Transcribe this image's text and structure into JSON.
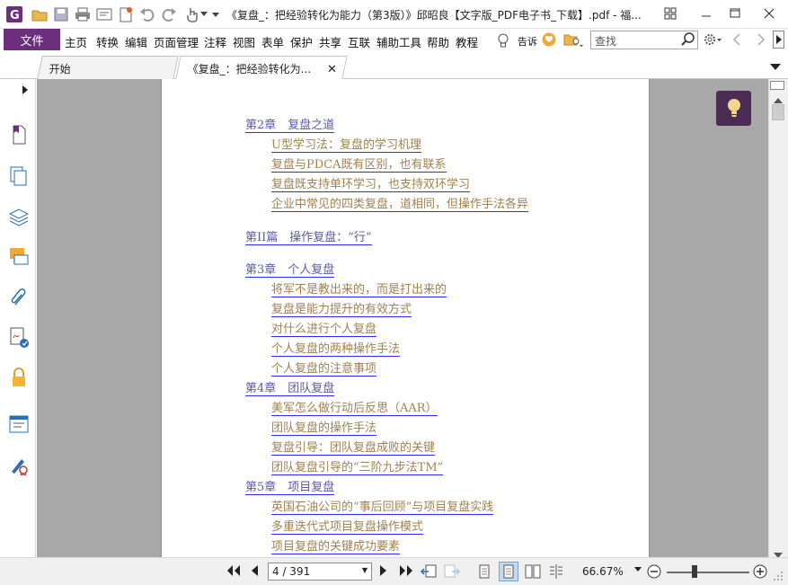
{
  "app": {
    "window_title": "《复盘_：把经验转化为能力（第3版）》邱昭良【文字版_PDF电子书_下载】.pdf - 福..."
  },
  "menu": {
    "file": "文件",
    "items": [
      "主页",
      "转换",
      "编辑",
      "页面管理",
      "注释",
      "视图",
      "表单",
      "保护",
      "共享",
      "互联",
      "辅助工具",
      "帮助",
      "教程"
    ],
    "tell_me": "告诉",
    "search_placeholder": "查找"
  },
  "tabs": [
    {
      "label": "开始"
    },
    {
      "label": "《复盘_：把经验转化为...",
      "closable": true
    }
  ],
  "left_panel_icons": [
    "bookmark-icon",
    "pages-icon",
    "layers-icon",
    "comments-icon",
    "attachments-icon",
    "signature-icon",
    "security-icon",
    "form-fields-icon",
    "fill-sign-icon"
  ],
  "toc": [
    {
      "text": "第2章　复盘之道",
      "level": "ch"
    },
    {
      "text": "U型学习法：复盘的学习机理",
      "level": "sec"
    },
    {
      "text": "复盘与PDCA既有区别，也有联系",
      "level": "sec"
    },
    {
      "text": "复盘既支持单环学习，也支持双环学习",
      "level": "sec"
    },
    {
      "text": "企业中常见的四类复盘，道相同，但操作手法各异",
      "level": "sec"
    },
    {
      "text": "第II篇　操作复盘：“行”",
      "level": "ch"
    },
    {
      "text": "第3章　个人复盘",
      "level": "ch"
    },
    {
      "text": "将军不是教出来的，而是打出来的",
      "level": "sec"
    },
    {
      "text": "复盘是能力提升的有效方式",
      "level": "sec"
    },
    {
      "text": "对什么进行个人复盘",
      "level": "sec"
    },
    {
      "text": "个人复盘的两种操作手法",
      "level": "sec"
    },
    {
      "text": "个人复盘的注意事项",
      "level": "sec"
    },
    {
      "text": "第4章　团队复盘",
      "level": "ch"
    },
    {
      "text": "美军怎么做行动后反思（AAR）",
      "level": "sec"
    },
    {
      "text": "团队复盘的操作手法",
      "level": "sec"
    },
    {
      "text": "复盘引导：团队复盘成败的关键",
      "level": "sec"
    },
    {
      "text": "团队复盘引导的“三阶九步法TM”",
      "level": "sec"
    },
    {
      "text": "第5章　项目复盘",
      "level": "ch"
    },
    {
      "text": "英国石油公司的“事后回顾”与项目复盘实践",
      "level": "sec"
    },
    {
      "text": "多重迭代式项目复盘操作模式",
      "level": "sec"
    },
    {
      "text": "项目复盘的关键成功要素",
      "level": "sec"
    }
  ],
  "status": {
    "page_input": "4 / 391",
    "current_page": 4,
    "total_pages": 391,
    "zoom": "66.67%"
  },
  "colors": {
    "accent": "#6b2f7e",
    "chapter_link": "#5b5aa6",
    "section_link": "#a0814f",
    "link_underline": "#2e2cff",
    "doc_background": "#a8a8a8"
  }
}
